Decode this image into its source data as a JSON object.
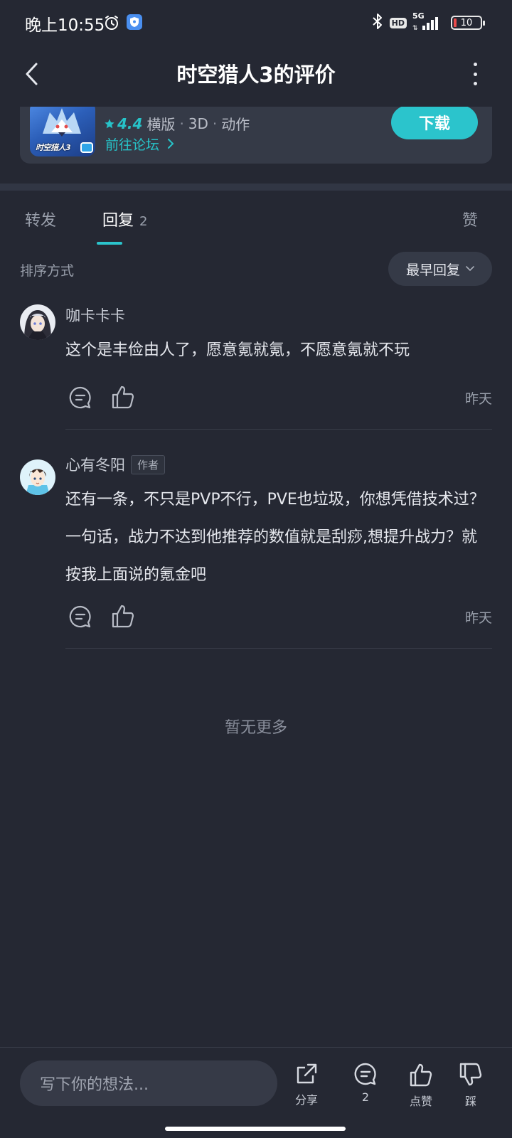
{
  "status_bar": {
    "time": "晚上10:55",
    "hd": "HD",
    "network": "5G",
    "battery": "10"
  },
  "header": {
    "title": "时空猎人3的评价"
  },
  "app_card": {
    "icon_text": "时空猎人3",
    "rating": "4.4",
    "tags": [
      "横版",
      "3D",
      "动作"
    ],
    "forum_link": "前往论坛",
    "download_label": "下载"
  },
  "tabs": {
    "repost": "转发",
    "reply": "回复",
    "reply_count": "2",
    "like": "赞"
  },
  "sort": {
    "label": "排序方式",
    "selected": "最早回复"
  },
  "comments": [
    {
      "username": "咖卡卡卡",
      "text": "这个是丰俭由人了，愿意氪就氪，不愿意氪就不玩",
      "date": "昨天"
    },
    {
      "username": "心有冬阳",
      "tag": "作者",
      "text": "还有一条，不只是PVP不行，PVE也垃圾，你想凭借技术过？一句话，战力不达到他推荐的数值就是刮痧,想提升战力？就按我上面说的氪金吧",
      "date": "昨天"
    }
  ],
  "no_more": "暂无更多",
  "bottom_bar": {
    "input_placeholder": "写下你的想法...",
    "share_label": "分享",
    "comment_count": "2",
    "like_label": "点赞",
    "dislike_label": "踩"
  },
  "colors": {
    "background": "#252833",
    "accent": "#2bc4cc",
    "card": "#353a47"
  }
}
